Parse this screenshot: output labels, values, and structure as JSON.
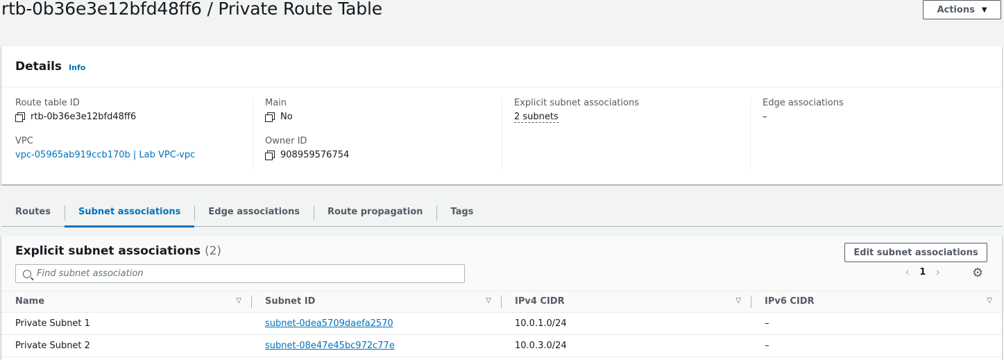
{
  "header": {
    "title": "rtb-0b36e3e12bfd48ff6 / Private Route Table",
    "actions_label": "Actions"
  },
  "details": {
    "title": "Details",
    "info_label": "Info",
    "route_table_id_label": "Route table ID",
    "route_table_id": "rtb-0b36e3e12bfd48ff6",
    "vpc_label": "VPC",
    "vpc": "vpc-05965ab919ccb170b | Lab VPC-vpc",
    "main_label": "Main",
    "main": "No",
    "owner_id_label": "Owner ID",
    "owner_id": "908959576754",
    "explicit_label": "Explicit subnet associations",
    "explicit": "2 subnets",
    "edge_label": "Edge associations",
    "edge": "–"
  },
  "tabs": [
    {
      "label": "Routes"
    },
    {
      "label": "Subnet associations"
    },
    {
      "label": "Edge associations"
    },
    {
      "label": "Route propagation"
    },
    {
      "label": "Tags"
    }
  ],
  "assoc": {
    "title": "Explicit subnet associations",
    "count": "(2)",
    "edit_label": "Edit subnet associations",
    "search_placeholder": "Find subnet association",
    "page": "1",
    "columns": [
      "Name",
      "Subnet ID",
      "IPv4 CIDR",
      "IPv6 CIDR"
    ],
    "rows": [
      {
        "name": "Private Subnet 1",
        "subnet_id": "subnet-0dea5709daefa2570",
        "ipv4": "10.0.1.0/24",
        "ipv6": "–"
      },
      {
        "name": "Private Subnet 2",
        "subnet_id": "subnet-08e47e45bc972c77e",
        "ipv4": "10.0.3.0/24",
        "ipv6": "–"
      }
    ]
  },
  "colors": {
    "link": "#0073bb",
    "text": "#16191f",
    "muted": "#545b64",
    "background": "#f2f3f3"
  }
}
